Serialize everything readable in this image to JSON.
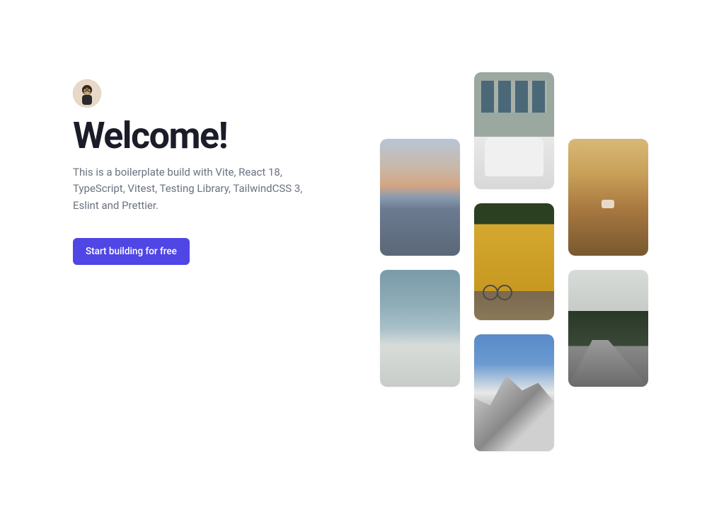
{
  "hero": {
    "heading": "Welcome!",
    "description": "This is a boilerplate build with Vite, React 18, TypeScript, Vitest, Testing Library, TailwindCSS 3, Eslint and Prettier.",
    "cta_label": "Start building for free"
  },
  "colors": {
    "accent": "#5046e5",
    "text_primary": "#1a1d29",
    "text_secondary": "#6b7280"
  },
  "gallery": {
    "columns": [
      {
        "offset": "middle",
        "items": [
          "ocean-sunset",
          "sky-clouds"
        ]
      },
      {
        "offset": "top",
        "items": [
          "building-car",
          "yellow-wall-bicycle",
          "snow-mountains"
        ]
      },
      {
        "offset": "middle",
        "items": [
          "desert-car-sunset",
          "forest-road"
        ]
      }
    ]
  }
}
